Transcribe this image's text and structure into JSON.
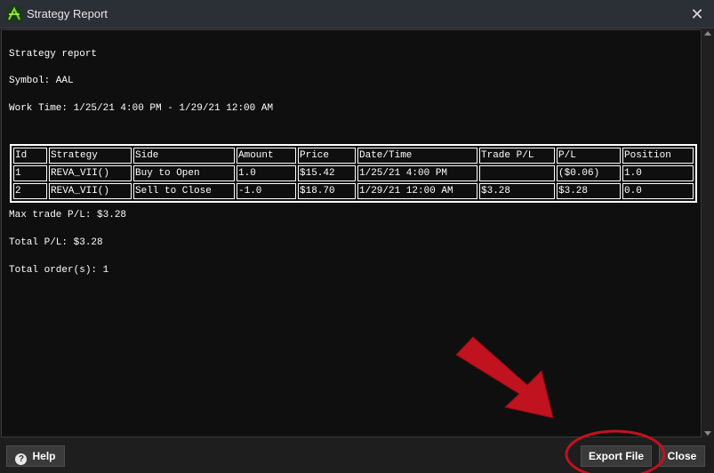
{
  "window": {
    "title": "Strategy Report"
  },
  "report": {
    "heading": "Strategy report",
    "symbol_line": "Symbol: AAL",
    "work_time_line": "Work Time: 1/25/21 4:00 PM - 1/29/21 12:00 AM",
    "columns": [
      "Id",
      "Strategy",
      "Side",
      "Amount",
      "Price",
      "Date/Time",
      "Trade P/L",
      "P/L",
      "Position"
    ],
    "rows": [
      [
        "1",
        "REVA_VII()",
        "Buy to Open",
        "1.0",
        "$15.42",
        "1/25/21 4:00 PM",
        "",
        "($0.06)",
        "1.0"
      ],
      [
        "2",
        "REVA_VII()",
        "Sell to Close",
        "-1.0",
        "$18.70",
        "1/29/21 12:00 AM",
        "$3.28",
        "$3.28",
        "0.0"
      ]
    ],
    "max_trade_line": "Max trade P/L: $3.28",
    "total_pl_line": "Total P/L: $3.28",
    "total_orders_line": "Total order(s): 1"
  },
  "footer": {
    "help_label": "Help",
    "export_label": "Export File",
    "close_label": "Close"
  },
  "colors": {
    "annotation_red": "#c1121f",
    "report_background": "#0f0f0f",
    "text": "#ffffff"
  },
  "icons": [
    "app-logo-icon",
    "close-icon",
    "help-icon",
    "scroll-up-icon",
    "scroll-down-icon"
  ]
}
